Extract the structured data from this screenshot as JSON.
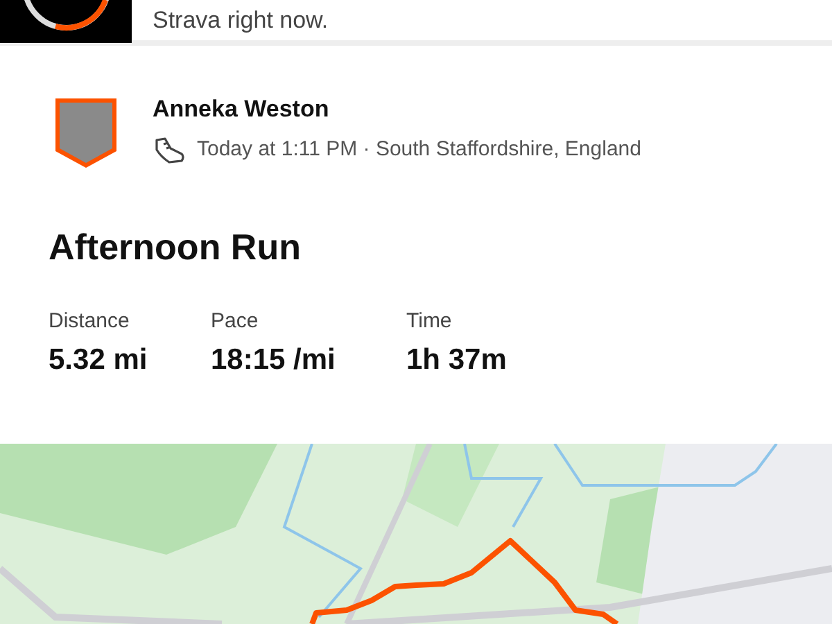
{
  "banner": {
    "text": "Strava right now."
  },
  "athlete": {
    "name": "Anneka Weston",
    "meta": "Today at 1:11 PM · South Staffordshire, England"
  },
  "activity": {
    "title": "Afternoon Run"
  },
  "stats": [
    {
      "label": "Distance",
      "value": "5.32 mi"
    },
    {
      "label": "Pace",
      "value": "18:15 /mi"
    },
    {
      "label": "Time",
      "value": "1h 37m"
    }
  ]
}
